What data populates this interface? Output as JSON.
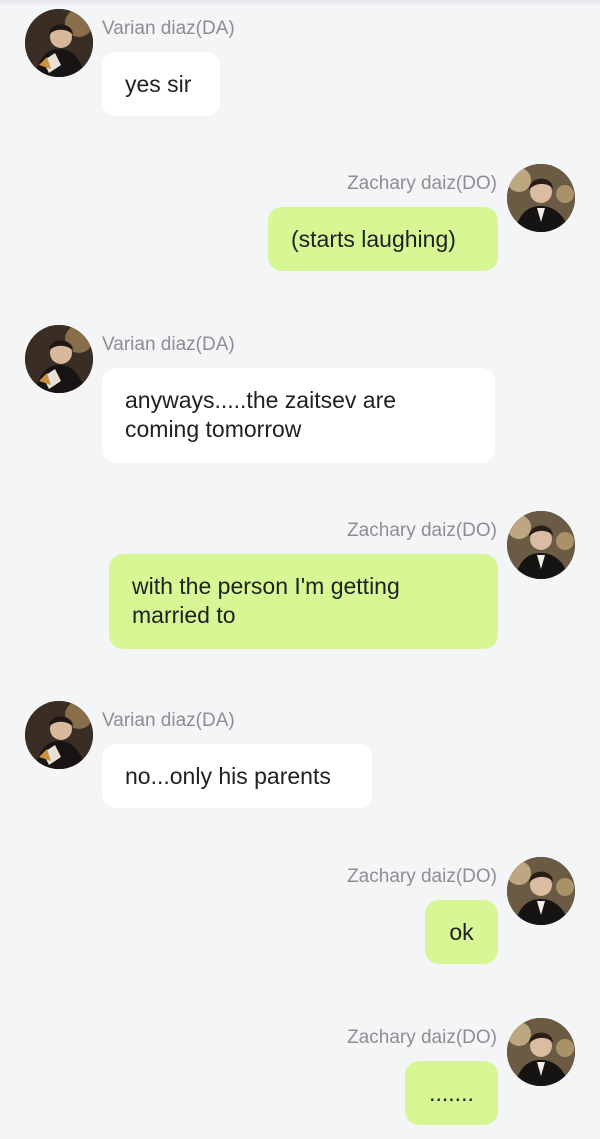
{
  "chat": {
    "messages": [
      {
        "side": "left",
        "sender": "Varian diaz(DA)",
        "text": "yes sir",
        "avatar": "varian-avatar"
      },
      {
        "side": "right",
        "sender": "Zachary daiz(DO)",
        "text": "(starts laughing)",
        "avatar": "zachary-avatar"
      },
      {
        "side": "left",
        "sender": "Varian diaz(DA)",
        "text": "anyways.....the zaitsev are coming tomorrow",
        "avatar": "varian-avatar"
      },
      {
        "side": "right",
        "sender": "Zachary daiz(DO)",
        "text": "with the person I'm getting married to",
        "avatar": "zachary-avatar"
      },
      {
        "side": "left",
        "sender": "Varian diaz(DA)",
        "text": "no...only his parents",
        "avatar": "varian-avatar"
      },
      {
        "side": "right",
        "sender": "Zachary daiz(DO)",
        "text": "ok",
        "avatar": "zachary-avatar"
      },
      {
        "side": "right",
        "sender": "Zachary daiz(DO)",
        "text": ".......",
        "avatar": "zachary-avatar"
      }
    ]
  },
  "colors": {
    "background": "#f4f5f7",
    "incoming_bubble": "#ffffff",
    "outgoing_bubble": "#d6f794",
    "sender_name": "#8c8e92",
    "message_text": "#202124"
  }
}
